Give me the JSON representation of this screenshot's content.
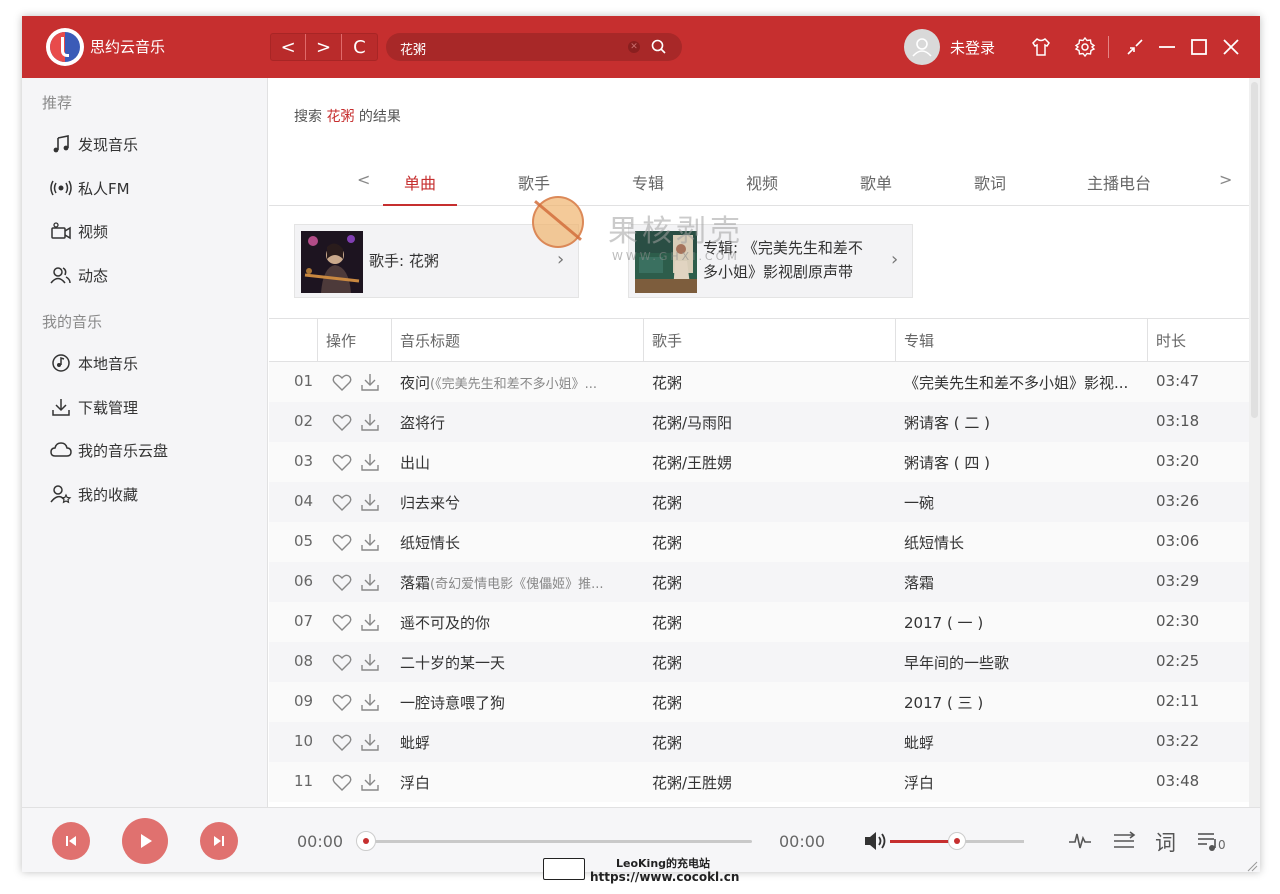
{
  "app": {
    "title": "思约云音乐"
  },
  "titlebar": {
    "nav_back": "<",
    "nav_forward": ">",
    "nav_refresh": "C",
    "search_value": "花粥",
    "login_label": "未登录"
  },
  "sidebar": {
    "section_recommend": "推荐",
    "recommend_items": [
      {
        "label": "发现音乐",
        "icon": "music-note-icon"
      },
      {
        "label": "私人FM",
        "icon": "radio-icon"
      },
      {
        "label": "视频",
        "icon": "video-icon"
      },
      {
        "label": "动态",
        "icon": "friends-icon"
      }
    ],
    "section_my_music": "我的音乐",
    "my_music_items": [
      {
        "label": "本地音乐",
        "icon": "disc-icon"
      },
      {
        "label": "下载管理",
        "icon": "download-icon"
      },
      {
        "label": "我的音乐云盘",
        "icon": "cloud-icon"
      },
      {
        "label": "我的收藏",
        "icon": "collection-icon"
      }
    ]
  },
  "main": {
    "result_prefix": "搜索",
    "result_keyword": "花粥",
    "result_suffix": "的结果",
    "tab_prev": "<",
    "tab_next": ">",
    "tabs": [
      "单曲",
      "歌手",
      "专辑",
      "视频",
      "歌单",
      "歌词",
      "主播电台"
    ],
    "active_tab": "单曲",
    "cards": [
      {
        "line1": "歌手: 花粥",
        "line2": ""
      },
      {
        "line1": "专辑: 《完美先生和差不",
        "line2": "多小姐》影视剧原声带"
      }
    ],
    "table": {
      "headers": [
        "操作",
        "音乐标题",
        "歌手",
        "专辑",
        "时长"
      ],
      "rows": [
        {
          "no": "01",
          "title": "夜问",
          "sub": "(《完美先生和差不多小姐》...",
          "artist": "花粥",
          "album": "《完美先生和差不多小姐》影视...",
          "duration": "03:47"
        },
        {
          "no": "02",
          "title": "盗将行",
          "sub": "",
          "artist": "花粥/马雨阳",
          "album": "粥请客 ( 二 )",
          "duration": "03:18"
        },
        {
          "no": "03",
          "title": "出山",
          "sub": "",
          "artist": "花粥/王胜娚",
          "album": "粥请客 ( 四 )",
          "duration": "03:20"
        },
        {
          "no": "04",
          "title": "归去来兮",
          "sub": "",
          "artist": "花粥",
          "album": "一碗",
          "duration": "03:26"
        },
        {
          "no": "05",
          "title": "纸短情长",
          "sub": "",
          "artist": "花粥",
          "album": "纸短情长",
          "duration": "03:06"
        },
        {
          "no": "06",
          "title": "落霜",
          "sub": "(奇幻爱情电影《傀儡姬》推...",
          "artist": "花粥",
          "album": "落霜",
          "duration": "03:29"
        },
        {
          "no": "07",
          "title": "遥不可及的你",
          "sub": "",
          "artist": "花粥",
          "album": "2017 ( 一 )",
          "duration": "02:30"
        },
        {
          "no": "08",
          "title": "二十岁的某一天",
          "sub": "",
          "artist": "花粥",
          "album": "早年间的一些歌",
          "duration": "02:25"
        },
        {
          "no": "09",
          "title": "一腔诗意喂了狗",
          "sub": "",
          "artist": "花粥",
          "album": "2017 ( 三 )",
          "duration": "02:11"
        },
        {
          "no": "10",
          "title": "蚍蜉",
          "sub": "",
          "artist": "花粥",
          "album": "蚍蜉",
          "duration": "03:22"
        },
        {
          "no": "11",
          "title": "浮白",
          "sub": "",
          "artist": "花粥/王胜娚",
          "album": "浮白",
          "duration": "03:48"
        }
      ]
    }
  },
  "watermark": {
    "text": "果核剥壳",
    "sub": "WWW.GHXI.COM"
  },
  "player": {
    "current_time": "00:00",
    "total_time": "00:00",
    "progress": 0,
    "volume": 0.5,
    "lyric_label": "词",
    "playlist_count": "0"
  },
  "footer": {
    "line1": "LeoKing的充电站",
    "line2": "https://www.cocokl.cn"
  },
  "colors": {
    "brand": "#c62f2f",
    "button": "#e0716f"
  }
}
